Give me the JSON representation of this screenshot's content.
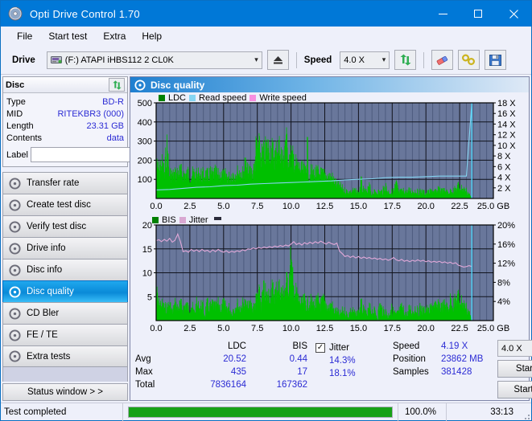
{
  "window": {
    "title": "Opti Drive Control 1.70",
    "icon": "disc-icon",
    "controls": {
      "minimize": "minimize-icon",
      "maximize": "maximize-icon",
      "close": "close-icon"
    }
  },
  "menu": {
    "items": [
      "File",
      "Start test",
      "Extra",
      "Help"
    ]
  },
  "toolbar": {
    "drive_label": "Drive",
    "drive_value": "(F:)  ATAPI iHBS112  2 CL0K",
    "eject_icon": "eject-icon",
    "speed_label": "Speed",
    "speed_value": "4.0 X",
    "refresh_icon": "refresh-icon",
    "eraser_icon": "eraser-icon",
    "tools_icon": "tools-icon",
    "save_icon": "save-icon"
  },
  "disc": {
    "title": "Disc",
    "refresh_icon": "refresh-icon",
    "rows": [
      {
        "key": "Type",
        "value": "BD-R"
      },
      {
        "key": "MID",
        "value": "RITEKBR3 (000)"
      },
      {
        "key": "Length",
        "value": "23.31 GB"
      },
      {
        "key": "Contents",
        "value": "data"
      }
    ],
    "label_key": "Label",
    "label_value": "",
    "label_placeholder": "",
    "label_button_icon": "disc-icon"
  },
  "nav": {
    "items": [
      {
        "label": "Transfer rate",
        "icon": "disc-icon",
        "active": false
      },
      {
        "label": "Create test disc",
        "icon": "disc-icon",
        "active": false
      },
      {
        "label": "Verify test disc",
        "icon": "disc-icon",
        "active": false
      },
      {
        "label": "Drive info",
        "icon": "disc-icon",
        "active": false
      },
      {
        "label": "Disc info",
        "icon": "disc-icon",
        "active": false
      },
      {
        "label": "Disc quality",
        "icon": "disc-icon",
        "active": true
      },
      {
        "label": "CD Bler",
        "icon": "disc-icon",
        "active": false
      },
      {
        "label": "FE / TE",
        "icon": "disc-icon",
        "active": false
      },
      {
        "label": "Extra tests",
        "icon": "disc-icon",
        "active": false
      }
    ],
    "status_window": "Status window > >"
  },
  "panel": {
    "title": "Disc quality",
    "icon": "disc-icon"
  },
  "stats": {
    "col_headers": [
      "LDC",
      "BIS"
    ],
    "rows": [
      {
        "label": "Avg",
        "ldc": "20.52",
        "bis": "0.44"
      },
      {
        "label": "Max",
        "ldc": "435",
        "bis": "17"
      },
      {
        "label": "Total",
        "ldc": "7836164",
        "bis": "167362"
      }
    ],
    "jitter_label": "Jitter",
    "jitter_checked": true,
    "jitter_avg": "14.3%",
    "jitter_max": "18.1%",
    "speed_label": "Speed",
    "speed_value": "4.19 X",
    "position_label": "Position",
    "position_value": "23862 MB",
    "samples_label": "Samples",
    "samples_value": "381428",
    "speed_select": "4.0 X",
    "start_full": "Start full",
    "start_part": "Start part"
  },
  "statusbar": {
    "text": "Test completed",
    "percent_label": "100.0%",
    "percent": 100,
    "elapsed": "33:13"
  },
  "colors": {
    "accent": "#0078d7",
    "ldc_green": "#00c000",
    "read_speed": "#86d5f2",
    "write_speed": "#f78fe0",
    "jitter_pink": "#e0a8d8",
    "plot_bg": "#69779b",
    "progress_green": "#17a117"
  },
  "chart_data": [
    {
      "type": "area",
      "title": "LDC / Read speed",
      "xlabel": "GB",
      "ylabel": "LDC",
      "xlim": [
        0,
        25
      ],
      "ylim": [
        0,
        500
      ],
      "y2lim": [
        0,
        18
      ],
      "y2label": "X",
      "xticks": [
        "0.0",
        "2.5",
        "5.0",
        "7.5",
        "10.0",
        "12.5",
        "15.0",
        "17.5",
        "20.0",
        "22.5",
        "25.0 GB"
      ],
      "yticks": [
        "100",
        "200",
        "300",
        "400",
        "500"
      ],
      "y2ticks": [
        "2 X",
        "4 X",
        "6 X",
        "8 X",
        "10 X",
        "12 X",
        "14 X",
        "16 X",
        "18 X"
      ],
      "grid": true,
      "legend": [
        "LDC",
        "Read speed",
        "Write speed"
      ],
      "legend_position": "top-left",
      "data_end_x": 23.4,
      "series": [
        {
          "name": "LDC",
          "color": "#00c000",
          "type": "bars",
          "x": [
            0.0,
            0.2,
            0.4,
            0.6,
            0.8,
            1.0,
            1.2,
            1.4,
            1.6,
            1.8,
            2.0,
            2.2,
            2.4,
            2.6,
            2.8,
            3.0,
            3.2,
            3.4,
            3.6,
            3.8,
            4.0,
            4.2,
            4.4,
            4.6,
            4.8,
            5.0,
            5.2,
            5.4,
            5.6,
            5.8,
            6.0,
            6.2,
            6.4,
            6.6,
            6.8,
            7.0,
            7.2,
            7.4,
            7.6,
            7.8,
            8.0,
            8.2,
            8.4,
            8.6,
            8.8,
            9.0,
            9.2,
            9.4,
            9.6,
            9.8,
            10.0,
            10.2,
            10.4,
            10.6,
            10.8,
            11.0,
            11.2,
            11.4,
            11.6,
            11.8,
            12.0,
            12.2,
            12.4,
            12.6,
            12.8,
            13.0,
            13.2,
            13.4,
            13.6,
            13.8,
            14.0,
            14.2,
            14.4,
            14.6,
            14.8,
            15.0,
            15.2,
            15.4,
            15.6,
            15.8,
            16.0,
            16.2,
            16.4,
            16.6,
            16.8,
            17.0,
            17.2,
            17.4,
            17.6,
            17.8,
            18.0,
            18.2,
            18.4,
            18.6,
            18.8,
            19.0,
            19.2,
            19.4,
            19.6,
            19.8,
            20.0,
            20.2,
            20.4,
            20.6,
            20.8,
            21.0,
            21.2,
            21.4,
            21.6,
            21.8,
            22.0,
            22.2,
            22.4,
            22.6,
            22.8,
            23.0,
            23.2,
            23.4
          ],
          "values": [
            230,
            205,
            250,
            195,
            355,
            180,
            165,
            170,
            185,
            190,
            175,
            170,
            180,
            165,
            175,
            160,
            175,
            165,
            170,
            160,
            175,
            165,
            180,
            160,
            170,
            155,
            165,
            150,
            170,
            175,
            180,
            185,
            175,
            245,
            180,
            190,
            185,
            340,
            355,
            300,
            310,
            350,
            345,
            330,
            300,
            360,
            345,
            280,
            435,
            300,
            290,
            280,
            230,
            215,
            200,
            190,
            350,
            180,
            185,
            175,
            180,
            170,
            165,
            160,
            155,
            150,
            130,
            100,
            95,
            75,
            60,
            55,
            50,
            60,
            55,
            50,
            125,
            55,
            50,
            90,
            45,
            50,
            55,
            50,
            60,
            100,
            55,
            50,
            60,
            110,
            50,
            55,
            60,
            50,
            65,
            55,
            60,
            50,
            55,
            50,
            45,
            50,
            55,
            60,
            50,
            80,
            55,
            60,
            50,
            55,
            60,
            70,
            95,
            80,
            70,
            60,
            40,
            0
          ]
        },
        {
          "name": "Read speed",
          "color": "#86d5f2",
          "type": "line",
          "x": [
            0.0,
            1.0,
            2.0,
            3.0,
            4.0,
            5.0,
            6.0,
            7.0,
            8.0,
            9.0,
            10.0,
            11.0,
            12.0,
            13.0,
            14.0,
            15.0,
            16.0,
            17.0,
            18.0,
            19.0,
            20.0,
            21.0,
            22.0,
            23.0,
            23.4
          ],
          "values": [
            1.6,
            1.7,
            1.9,
            2.1,
            2.2,
            2.4,
            2.5,
            2.7,
            2.8,
            2.9,
            3.0,
            3.1,
            3.2,
            3.3,
            3.5,
            3.6,
            3.7,
            3.9,
            4.0,
            4.0,
            4.1,
            4.2,
            4.2,
            4.2,
            18.0
          ]
        },
        {
          "name": "Write speed",
          "color": "#f78fe0",
          "type": "line",
          "x": [],
          "values": []
        }
      ]
    },
    {
      "type": "area",
      "title": "BIS / Jitter",
      "xlabel": "GB",
      "ylabel": "BIS",
      "xlim": [
        0,
        25
      ],
      "ylim": [
        0,
        20
      ],
      "y2lim": [
        0,
        20
      ],
      "y2label": "%",
      "xticks": [
        "0.0",
        "2.5",
        "5.0",
        "7.5",
        "10.0",
        "12.5",
        "15.0",
        "17.5",
        "20.0",
        "22.5",
        "25.0 GB"
      ],
      "yticks": [
        "5",
        "10",
        "15",
        "20"
      ],
      "y2ticks": [
        "4%",
        "8%",
        "12%",
        "16%",
        "20%"
      ],
      "grid": true,
      "legend": [
        "BIS",
        "Jitter"
      ],
      "legend_position": "top-left",
      "data_end_x": 23.4,
      "series": [
        {
          "name": "BIS",
          "color": "#00c000",
          "type": "bars",
          "x": [
            0.0,
            0.2,
            0.4,
            0.6,
            0.8,
            1.0,
            1.2,
            1.4,
            1.6,
            1.8,
            2.0,
            2.2,
            2.4,
            2.6,
            2.8,
            3.0,
            3.2,
            3.4,
            3.6,
            3.8,
            4.0,
            4.2,
            4.4,
            4.6,
            4.8,
            5.0,
            5.2,
            5.4,
            5.6,
            5.8,
            6.0,
            6.2,
            6.4,
            6.6,
            6.8,
            7.0,
            7.2,
            7.4,
            7.6,
            7.8,
            8.0,
            8.2,
            8.4,
            8.6,
            8.8,
            9.0,
            9.2,
            9.4,
            9.6,
            9.8,
            10.0,
            10.2,
            10.4,
            10.6,
            10.8,
            11.0,
            11.2,
            11.4,
            11.6,
            11.8,
            12.0,
            12.2,
            12.4,
            12.6,
            12.8,
            13.0,
            13.2,
            13.4,
            13.6,
            13.8,
            14.0,
            14.2,
            14.4,
            14.6,
            14.8,
            15.0,
            15.2,
            15.4,
            15.6,
            15.8,
            16.0,
            16.2,
            16.4,
            16.6,
            16.8,
            17.0,
            17.2,
            17.4,
            17.6,
            17.8,
            18.0,
            18.2,
            18.4,
            18.6,
            18.8,
            19.0,
            19.2,
            19.4,
            19.6,
            19.8,
            20.0,
            20.2,
            20.4,
            20.6,
            20.8,
            21.0,
            21.2,
            21.4,
            21.6,
            21.8,
            22.0,
            22.2,
            22.4,
            22.6,
            22.8,
            23.0,
            23.2,
            23.4
          ],
          "values": [
            9,
            5,
            5,
            4,
            4,
            5,
            3,
            5,
            4,
            5,
            4,
            5,
            4,
            5,
            3,
            5,
            4,
            5,
            3,
            5,
            4,
            5,
            4,
            5,
            4,
            5,
            4,
            4,
            3,
            4,
            5,
            4,
            5,
            5,
            4,
            5,
            4,
            6,
            8,
            6,
            9,
            7,
            8,
            9,
            8,
            10,
            9,
            8,
            10,
            12,
            17,
            9,
            8,
            6,
            5,
            6,
            5,
            6,
            5,
            5,
            6,
            5,
            6,
            5,
            4,
            5,
            3,
            3,
            2,
            3,
            3,
            2,
            3,
            3,
            2,
            3,
            5,
            3,
            2,
            4,
            3,
            3,
            2,
            5,
            3,
            3,
            2,
            4,
            3,
            2,
            3,
            4,
            3,
            2,
            4,
            3,
            4,
            3,
            4,
            3,
            4,
            3,
            4,
            5,
            4,
            5,
            4,
            5,
            4,
            6,
            5,
            6,
            7,
            6,
            5,
            4,
            3,
            0
          ]
        },
        {
          "name": "Jitter",
          "color": "#e0a8d8",
          "type": "line",
          "x": [
            0.0,
            0.2,
            0.4,
            0.6,
            0.8,
            1.0,
            1.2,
            1.4,
            1.6,
            1.8,
            2.0,
            2.2,
            2.4,
            2.6,
            2.8,
            3.0,
            3.2,
            3.4,
            3.6,
            3.8,
            4.0,
            4.2,
            4.4,
            4.6,
            4.8,
            5.0,
            5.2,
            5.4,
            5.6,
            5.8,
            6.0,
            6.2,
            6.4,
            6.6,
            6.8,
            7.0,
            7.2,
            7.4,
            7.6,
            7.8,
            8.0,
            8.2,
            8.4,
            8.6,
            8.8,
            9.0,
            9.2,
            9.4,
            9.6,
            9.8,
            10.0,
            10.2,
            10.4,
            10.6,
            10.8,
            11.0,
            11.2,
            11.4,
            11.6,
            11.8,
            12.0,
            12.2,
            12.4,
            12.6,
            12.8,
            13.0,
            13.2,
            13.4,
            13.6,
            13.8,
            14.0,
            14.2,
            14.4,
            14.6,
            14.8,
            15.0,
            15.2,
            15.4,
            15.6,
            15.8,
            16.0,
            16.2,
            16.4,
            16.6,
            16.8,
            17.0,
            17.2,
            17.4,
            17.6,
            17.8,
            18.0,
            18.2,
            18.4,
            18.6,
            18.8,
            19.0,
            19.2,
            19.4,
            19.6,
            19.8,
            20.0,
            20.2,
            20.4,
            20.6,
            20.8,
            21.0,
            21.2,
            21.4,
            21.6,
            21.8,
            22.0,
            22.2,
            22.4,
            22.6,
            22.8,
            23.0,
            23.2,
            23.4
          ],
          "values": [
            16.7,
            16.9,
            16.5,
            17.0,
            16.6,
            17.2,
            16.4,
            16.8,
            18.1,
            16.5,
            14.4,
            14.6,
            14.3,
            14.9,
            14.5,
            14.8,
            14.4,
            14.9,
            14.5,
            14.7,
            14.3,
            14.8,
            14.4,
            14.9,
            14.5,
            14.3,
            14.6,
            14.2,
            14.5,
            14.3,
            14.6,
            14.4,
            14.8,
            14.6,
            15.0,
            14.9,
            15.2,
            15.0,
            15.3,
            15.1,
            15.4,
            15.2,
            15.5,
            15.3,
            15.6,
            15.4,
            15.7,
            15.5,
            15.8,
            15.6,
            16.0,
            16.5,
            15.9,
            16.2,
            15.8,
            16.3,
            16.0,
            16.4,
            16.1,
            16.5,
            16.2,
            16.6,
            16.3,
            16.0,
            16.4,
            16.1,
            15.9,
            16.2,
            14.5,
            14.0,
            13.4,
            13.6,
            13.2,
            13.5,
            13.1,
            13.4,
            13.0,
            13.3,
            13.0,
            13.2,
            12.9,
            13.1,
            12.8,
            13.0,
            12.7,
            12.9,
            12.6,
            12.8,
            13.2,
            12.7,
            12.5,
            12.8,
            12.4,
            12.6,
            12.3,
            12.6,
            12.4,
            12.7,
            12.4,
            12.6,
            12.3,
            12.5,
            12.2,
            12.4,
            12.2,
            12.4,
            12.1,
            12.3,
            12.0,
            12.2,
            11.9,
            12.1,
            11.6,
            11.4,
            11.2,
            11.3,
            11.5,
            11.3
          ]
        }
      ]
    }
  ]
}
